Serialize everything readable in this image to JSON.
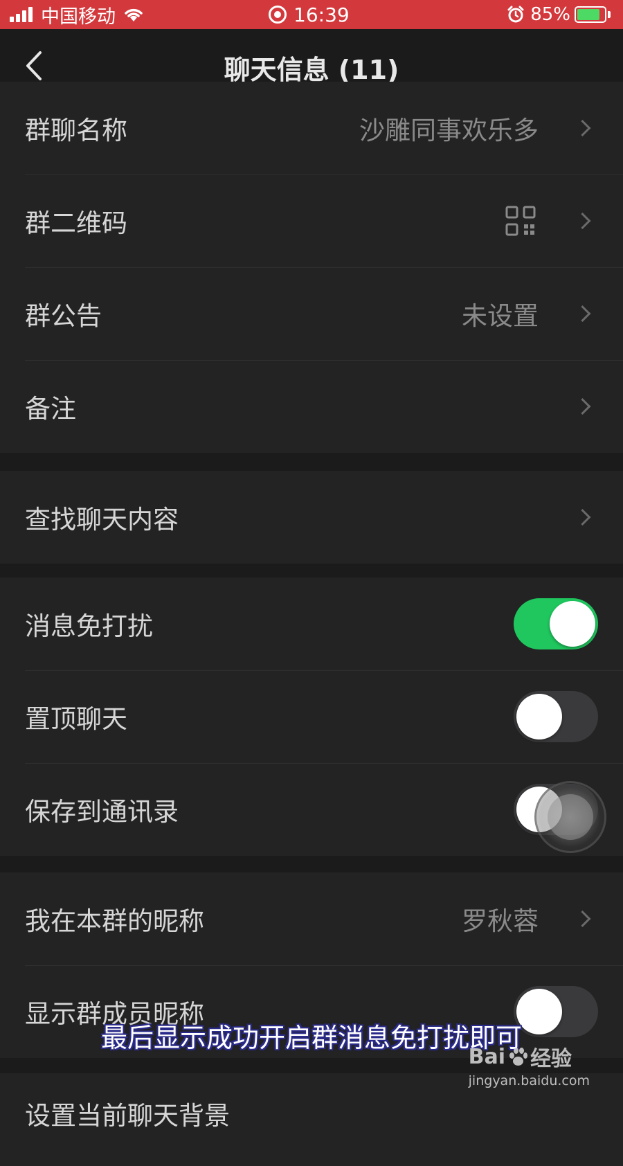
{
  "status_bar": {
    "carrier": "中国移动",
    "time": "16:39",
    "battery": "85%",
    "battery_level": 0.85
  },
  "nav": {
    "title": "聊天信息 (11)"
  },
  "group1": [
    {
      "label": "群聊名称",
      "value": "沙雕同事欢乐多"
    },
    {
      "label": "群二维码",
      "icon": "qr-code-icon"
    },
    {
      "label": "群公告",
      "value": "未设置"
    },
    {
      "label": "备注"
    }
  ],
  "group2": [
    {
      "label": "查找聊天内容"
    }
  ],
  "group3": [
    {
      "label": "消息免打扰",
      "toggle": true
    },
    {
      "label": "置顶聊天",
      "toggle": false
    },
    {
      "label": "保存到通讯录",
      "toggle": false
    }
  ],
  "group4": [
    {
      "label": "我在本群的昵称",
      "value": "罗秋蓉"
    },
    {
      "label": "显示群成员昵称",
      "toggle": false
    }
  ],
  "group5": [
    {
      "label": "设置当前聊天背景"
    }
  ],
  "overlay": {
    "subtitle": "最后显示成功开启群消息免打扰即可",
    "watermark_logo_left": "Bai",
    "watermark_logo_right": "经验",
    "watermark_url": "jingyan.baidu.com"
  },
  "colors": {
    "status_bar": "#d3393c",
    "toggle_on": "#1fc75e",
    "background": "#1b1b1b",
    "cell": "#232323"
  }
}
